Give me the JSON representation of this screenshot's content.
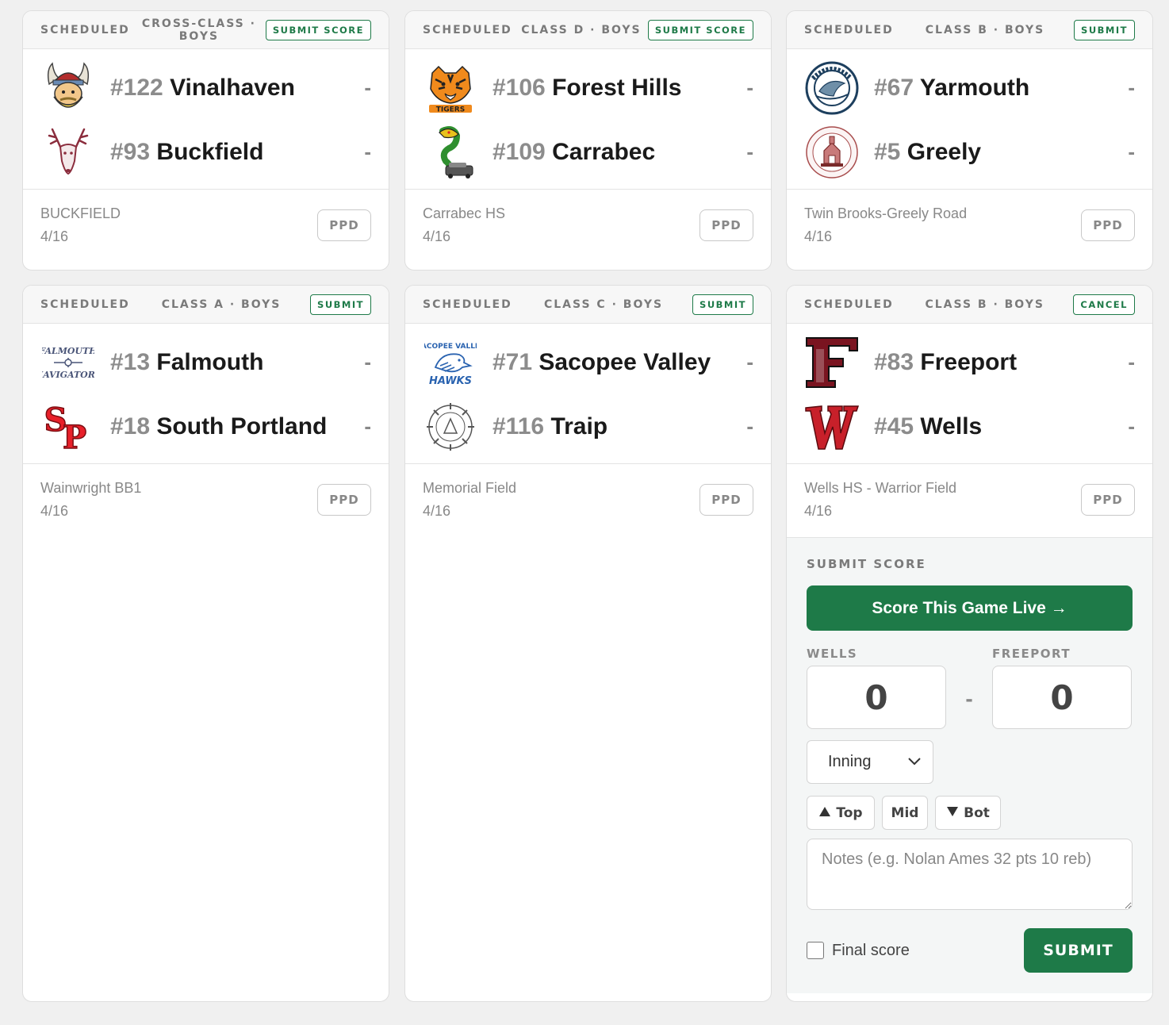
{
  "games": [
    {
      "status": "SCHEDULED",
      "class": "CROSS-CLASS · BOYS",
      "action": "SUBMIT SCORE",
      "home": {
        "rank": "#122",
        "name": "Vinalhaven",
        "score": "-",
        "logo": "viking-icon"
      },
      "away": {
        "rank": "#93",
        "name": "Buckfield",
        "score": "-",
        "logo": "buck-icon"
      },
      "venue": "BUCKFIELD",
      "date": "4/16",
      "ppd": "PPD"
    },
    {
      "status": "SCHEDULED",
      "class": "CLASS D · BOYS",
      "action": "SUBMIT SCORE",
      "home": {
        "rank": "#106",
        "name": "Forest Hills",
        "score": "-",
        "logo": "tiger-icon"
      },
      "away": {
        "rank": "#109",
        "name": "Carrabec",
        "score": "-",
        "logo": "cobra-icon"
      },
      "venue": "Carrabec HS",
      "date": "4/16",
      "ppd": "PPD"
    },
    {
      "status": "SCHEDULED",
      "class": "CLASS B · BOYS",
      "action": "SUBMIT",
      "home": {
        "rank": "#67",
        "name": "Yarmouth",
        "score": "-",
        "logo": "clipper-icon"
      },
      "away": {
        "rank": "#5",
        "name": "Greely",
        "score": "-",
        "logo": "greely-seal-icon"
      },
      "venue": "Twin Brooks-Greely Road",
      "date": "4/16",
      "ppd": "PPD"
    },
    {
      "status": "SCHEDULED",
      "class": "CLASS A · BOYS",
      "action": "SUBMIT",
      "home": {
        "rank": "#13",
        "name": "Falmouth",
        "score": "-",
        "logo": "navigators-icon"
      },
      "away": {
        "rank": "#18",
        "name": "South Portland",
        "score": "-",
        "logo": "sp-icon"
      },
      "venue": "Wainwright BB1",
      "date": "4/16",
      "ppd": "PPD"
    },
    {
      "status": "SCHEDULED",
      "class": "CLASS C · BOYS",
      "action": "SUBMIT",
      "home": {
        "rank": "#71",
        "name": "Sacopee Valley",
        "score": "-",
        "logo": "hawk-icon"
      },
      "away": {
        "rank": "#116",
        "name": "Traip",
        "score": "-",
        "logo": "traip-seal-icon"
      },
      "venue": "Memorial Field",
      "date": "4/16",
      "ppd": "PPD"
    },
    {
      "status": "SCHEDULED",
      "class": "CLASS B · BOYS",
      "action": "CANCEL",
      "home": {
        "rank": "#83",
        "name": "Freeport",
        "score": "-",
        "logo": "f-letter-icon"
      },
      "away": {
        "rank": "#45",
        "name": "Wells",
        "score": "-",
        "logo": "w-letter-icon"
      },
      "venue": "Wells HS - Warrior Field",
      "date": "4/16",
      "ppd": "PPD"
    }
  ],
  "score_panel": {
    "title": "SUBMIT SCORE",
    "live_button": "Score This Game Live →",
    "team1_label": "WELLS",
    "team1_score": "0",
    "team2_label": "FREEPORT",
    "team2_score": "0",
    "separator": "-",
    "inning_placeholder": "Inning",
    "half_top": "Top",
    "half_mid": "Mid",
    "half_bot": "Bot",
    "notes_placeholder": "Notes (e.g. Nolan Ames 32 pts 10 reb)",
    "final_label": "Final score",
    "submit_label": "SUBMIT"
  },
  "colors": {
    "accent": "#1e7a48",
    "muted": "#888888",
    "background": "#f0f0f0"
  }
}
